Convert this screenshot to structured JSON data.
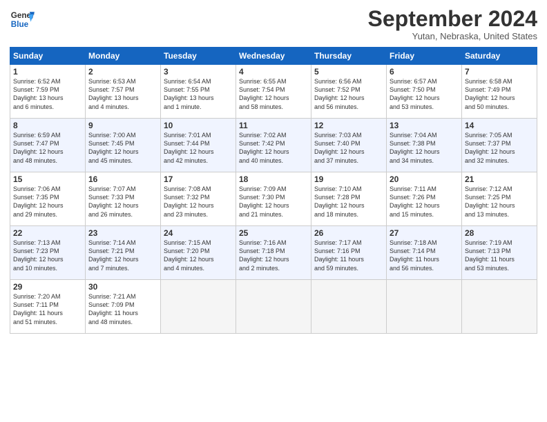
{
  "header": {
    "logo_line1": "General",
    "logo_line2": "Blue",
    "month": "September 2024",
    "location": "Yutan, Nebraska, United States"
  },
  "weekdays": [
    "Sunday",
    "Monday",
    "Tuesday",
    "Wednesday",
    "Thursday",
    "Friday",
    "Saturday"
  ],
  "weeks": [
    [
      {
        "day": "1",
        "lines": [
          "Sunrise: 6:52 AM",
          "Sunset: 7:59 PM",
          "Daylight: 13 hours",
          "and 6 minutes."
        ]
      },
      {
        "day": "2",
        "lines": [
          "Sunrise: 6:53 AM",
          "Sunset: 7:57 PM",
          "Daylight: 13 hours",
          "and 4 minutes."
        ]
      },
      {
        "day": "3",
        "lines": [
          "Sunrise: 6:54 AM",
          "Sunset: 7:55 PM",
          "Daylight: 13 hours",
          "and 1 minute."
        ]
      },
      {
        "day": "4",
        "lines": [
          "Sunrise: 6:55 AM",
          "Sunset: 7:54 PM",
          "Daylight: 12 hours",
          "and 58 minutes."
        ]
      },
      {
        "day": "5",
        "lines": [
          "Sunrise: 6:56 AM",
          "Sunset: 7:52 PM",
          "Daylight: 12 hours",
          "and 56 minutes."
        ]
      },
      {
        "day": "6",
        "lines": [
          "Sunrise: 6:57 AM",
          "Sunset: 7:50 PM",
          "Daylight: 12 hours",
          "and 53 minutes."
        ]
      },
      {
        "day": "7",
        "lines": [
          "Sunrise: 6:58 AM",
          "Sunset: 7:49 PM",
          "Daylight: 12 hours",
          "and 50 minutes."
        ]
      }
    ],
    [
      {
        "day": "8",
        "lines": [
          "Sunrise: 6:59 AM",
          "Sunset: 7:47 PM",
          "Daylight: 12 hours",
          "and 48 minutes."
        ]
      },
      {
        "day": "9",
        "lines": [
          "Sunrise: 7:00 AM",
          "Sunset: 7:45 PM",
          "Daylight: 12 hours",
          "and 45 minutes."
        ]
      },
      {
        "day": "10",
        "lines": [
          "Sunrise: 7:01 AM",
          "Sunset: 7:44 PM",
          "Daylight: 12 hours",
          "and 42 minutes."
        ]
      },
      {
        "day": "11",
        "lines": [
          "Sunrise: 7:02 AM",
          "Sunset: 7:42 PM",
          "Daylight: 12 hours",
          "and 40 minutes."
        ]
      },
      {
        "day": "12",
        "lines": [
          "Sunrise: 7:03 AM",
          "Sunset: 7:40 PM",
          "Daylight: 12 hours",
          "and 37 minutes."
        ]
      },
      {
        "day": "13",
        "lines": [
          "Sunrise: 7:04 AM",
          "Sunset: 7:38 PM",
          "Daylight: 12 hours",
          "and 34 minutes."
        ]
      },
      {
        "day": "14",
        "lines": [
          "Sunrise: 7:05 AM",
          "Sunset: 7:37 PM",
          "Daylight: 12 hours",
          "and 32 minutes."
        ]
      }
    ],
    [
      {
        "day": "15",
        "lines": [
          "Sunrise: 7:06 AM",
          "Sunset: 7:35 PM",
          "Daylight: 12 hours",
          "and 29 minutes."
        ]
      },
      {
        "day": "16",
        "lines": [
          "Sunrise: 7:07 AM",
          "Sunset: 7:33 PM",
          "Daylight: 12 hours",
          "and 26 minutes."
        ]
      },
      {
        "day": "17",
        "lines": [
          "Sunrise: 7:08 AM",
          "Sunset: 7:32 PM",
          "Daylight: 12 hours",
          "and 23 minutes."
        ]
      },
      {
        "day": "18",
        "lines": [
          "Sunrise: 7:09 AM",
          "Sunset: 7:30 PM",
          "Daylight: 12 hours",
          "and 21 minutes."
        ]
      },
      {
        "day": "19",
        "lines": [
          "Sunrise: 7:10 AM",
          "Sunset: 7:28 PM",
          "Daylight: 12 hours",
          "and 18 minutes."
        ]
      },
      {
        "day": "20",
        "lines": [
          "Sunrise: 7:11 AM",
          "Sunset: 7:26 PM",
          "Daylight: 12 hours",
          "and 15 minutes."
        ]
      },
      {
        "day": "21",
        "lines": [
          "Sunrise: 7:12 AM",
          "Sunset: 7:25 PM",
          "Daylight: 12 hours",
          "and 13 minutes."
        ]
      }
    ],
    [
      {
        "day": "22",
        "lines": [
          "Sunrise: 7:13 AM",
          "Sunset: 7:23 PM",
          "Daylight: 12 hours",
          "and 10 minutes."
        ]
      },
      {
        "day": "23",
        "lines": [
          "Sunrise: 7:14 AM",
          "Sunset: 7:21 PM",
          "Daylight: 12 hours",
          "and 7 minutes."
        ]
      },
      {
        "day": "24",
        "lines": [
          "Sunrise: 7:15 AM",
          "Sunset: 7:20 PM",
          "Daylight: 12 hours",
          "and 4 minutes."
        ]
      },
      {
        "day": "25",
        "lines": [
          "Sunrise: 7:16 AM",
          "Sunset: 7:18 PM",
          "Daylight: 12 hours",
          "and 2 minutes."
        ]
      },
      {
        "day": "26",
        "lines": [
          "Sunrise: 7:17 AM",
          "Sunset: 7:16 PM",
          "Daylight: 11 hours",
          "and 59 minutes."
        ]
      },
      {
        "day": "27",
        "lines": [
          "Sunrise: 7:18 AM",
          "Sunset: 7:14 PM",
          "Daylight: 11 hours",
          "and 56 minutes."
        ]
      },
      {
        "day": "28",
        "lines": [
          "Sunrise: 7:19 AM",
          "Sunset: 7:13 PM",
          "Daylight: 11 hours",
          "and 53 minutes."
        ]
      }
    ],
    [
      {
        "day": "29",
        "lines": [
          "Sunrise: 7:20 AM",
          "Sunset: 7:11 PM",
          "Daylight: 11 hours",
          "and 51 minutes."
        ]
      },
      {
        "day": "30",
        "lines": [
          "Sunrise: 7:21 AM",
          "Sunset: 7:09 PM",
          "Daylight: 11 hours",
          "and 48 minutes."
        ]
      },
      null,
      null,
      null,
      null,
      null
    ]
  ]
}
